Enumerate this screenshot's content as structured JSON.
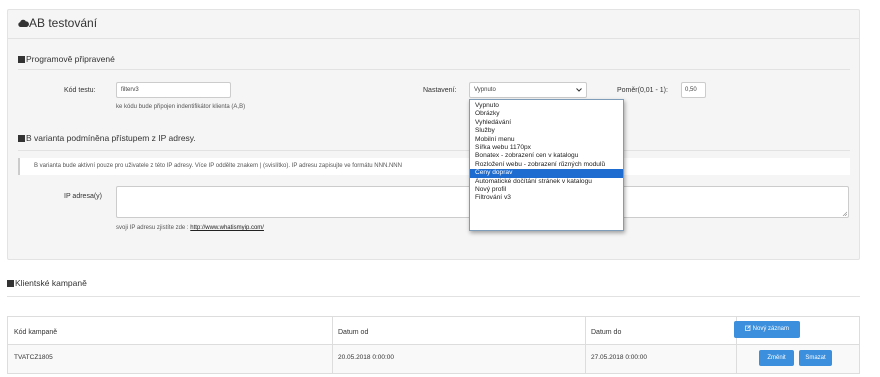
{
  "panel": {
    "title": "AB testování",
    "section_preset": "Programově připravené",
    "test_code_label": "Kód testu:",
    "test_code_value": "filterv3",
    "test_code_help": "ke kódu bude připojen indentifikátor klienta (A,B)",
    "setting_label": "Nastavení:",
    "setting_selected": "Vypnuto",
    "ratio_label": "Poměr(0,01 - 1):",
    "ratio_value": "0,50",
    "section_b_variant": "B varianta podmíněna přístupem z IP adresy.",
    "b_variant_info": "B varianta bude aktivní pouze pro uživatele z této IP adresy. Více IP oddělte znakem | (svislítko). IP adresu zapisujte ve formátu NNN.NNN",
    "ip_label": "IP adresa(y)",
    "ip_value": "",
    "ip_help_prefix": "svoji IP adresu zjistíte zde : ",
    "ip_help_link": "http://www.whatismyip.com/"
  },
  "dropdown": {
    "options": [
      "Vypnuto",
      "Obrázky",
      "Vyhledávání",
      "Služby",
      "Mobilní menu",
      "Šířka webu 1170px",
      "Bonatex - zobrazení cen v katalogu",
      "Rozložení webu - zobrazení různých modulů",
      "Ceny doprav",
      "Automatické dočítání stránek v katalogu",
      "Nový profil",
      "Filtrování v3"
    ],
    "highlighted": "Ceny doprav"
  },
  "campaigns": {
    "title": "Klientské kampaně",
    "columns": [
      "Kód kampaně",
      "Datum od",
      "Datum do"
    ],
    "new_button": "Nový záznam",
    "rows": [
      {
        "code": "TVATCZ1805",
        "from": "20.05.2018 0:00:00",
        "to": "27.05.2018 0:00:00",
        "edit": "Změnit",
        "delete": "Smazat"
      }
    ]
  },
  "icons": [
    "cloud-icon",
    "section-bar-icon",
    "edit-icon",
    "dropdown-chevron-icon",
    "resize-handle-icon"
  ],
  "colors": {
    "accent": "#3c8fdc",
    "panel_bg": "#f5f5f5",
    "selected_option": "#1e6cd0"
  }
}
